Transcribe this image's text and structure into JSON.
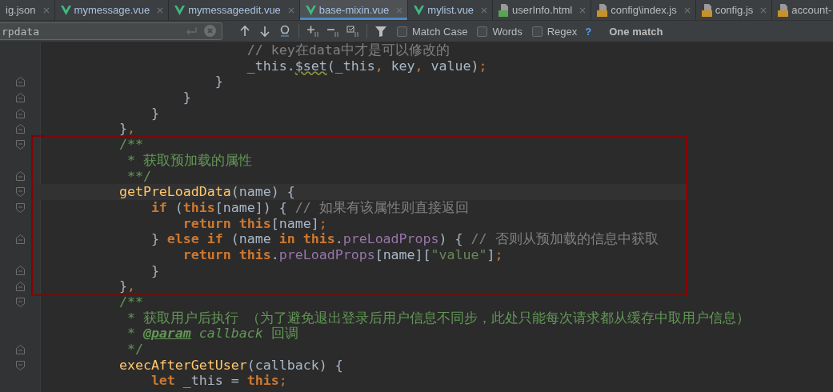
{
  "tabs": [
    {
      "label": "ig.json",
      "kind": "plain",
      "selected": false
    },
    {
      "label": "mymessage.vue",
      "kind": "vue",
      "selected": false
    },
    {
      "label": "mymessageedit.vue",
      "kind": "vue",
      "selected": false
    },
    {
      "label": "base-mixin.vue",
      "kind": "vue",
      "selected": true
    },
    {
      "label": "mylist.vue",
      "kind": "vue",
      "selected": false
    },
    {
      "label": "userInfo.html",
      "kind": "html",
      "selected": false
    },
    {
      "label": "config\\index.js",
      "kind": "js",
      "selected": false
    },
    {
      "label": "config.js",
      "kind": "js",
      "selected": false
    },
    {
      "label": "account-",
      "kind": "js",
      "selected": false
    }
  ],
  "search": {
    "value": "rpdata",
    "options": [
      {
        "label": "Match Case",
        "checked": false
      },
      {
        "label": "Words",
        "checked": false
      },
      {
        "label": "Regex",
        "checked": false
      }
    ],
    "help": "?",
    "result": "One match"
  },
  "editor": {
    "blocks": [
      {
        "highlighted": false,
        "lines": [
          {
            "kind": "plain",
            "current": false,
            "tokens": [
              {
                "kind": "comment",
                "text": "                        // key在data中才是可以修改的"
              }
            ]
          },
          {
            "kind": "plain",
            "current": false,
            "tokens": [
              {
                "kind": "plain",
                "text": "                        _this."
              },
              {
                "kind": "warn",
                "text": "$set"
              },
              {
                "kind": "plain",
                "text": "(_this"
              },
              {
                "kind": "punc",
                "text": ","
              },
              {
                "kind": "plain",
                "text": " key"
              },
              {
                "kind": "punc",
                "text": ","
              },
              {
                "kind": "plain",
                "text": " value)"
              },
              {
                "kind": "punc",
                "text": ";"
              }
            ]
          },
          {
            "kind": "fold-end",
            "current": false,
            "tokens": [
              {
                "kind": "plain",
                "text": "                    }"
              }
            ]
          },
          {
            "kind": "fold-end",
            "current": false,
            "tokens": [
              {
                "kind": "plain",
                "text": "                }"
              }
            ]
          },
          {
            "kind": "fold-end",
            "current": false,
            "tokens": [
              {
                "kind": "plain",
                "text": "            }"
              }
            ]
          },
          {
            "kind": "fold-end",
            "current": false,
            "tokens": [
              {
                "kind": "plain",
                "text": "        }"
              },
              {
                "kind": "punc",
                "text": ","
              }
            ]
          }
        ]
      },
      {
        "highlighted": true,
        "lines": [
          {
            "kind": "fold-start",
            "current": false,
            "tokens": [
              {
                "kind": "doc",
                "text": "        /**"
              }
            ]
          },
          {
            "kind": "plain",
            "current": false,
            "tokens": [
              {
                "kind": "doc",
                "text": "         * 获取预加载的属性"
              }
            ]
          },
          {
            "kind": "fold-end",
            "current": false,
            "tokens": [
              {
                "kind": "doc",
                "text": "         **/"
              }
            ]
          },
          {
            "kind": "fold-start",
            "current": true,
            "tokens": [
              {
                "kind": "fn",
                "text": "        getPreLoadData"
              },
              {
                "kind": "plain",
                "text": "(name) {"
              }
            ]
          },
          {
            "kind": "fold-start",
            "current": false,
            "tokens": [
              {
                "kind": "kw",
                "text": "            if"
              },
              {
                "kind": "plain",
                "text": " ("
              },
              {
                "kind": "kw",
                "text": "this"
              },
              {
                "kind": "plain",
                "text": "[name]) { "
              },
              {
                "kind": "comment",
                "text": "// 如果有该属性则直接返回"
              }
            ]
          },
          {
            "kind": "plain",
            "current": false,
            "tokens": [
              {
                "kind": "kw",
                "text": "                return this"
              },
              {
                "kind": "plain",
                "text": "[name]"
              },
              {
                "kind": "punc",
                "text": ";"
              }
            ]
          },
          {
            "kind": "fold-end",
            "current": false,
            "tokens": [
              {
                "kind": "plain",
                "text": "            } "
              },
              {
                "kind": "kw",
                "text": "else if"
              },
              {
                "kind": "plain",
                "text": " (name "
              },
              {
                "kind": "kw",
                "text": "in this"
              },
              {
                "kind": "plain",
                "text": "."
              },
              {
                "kind": "prop",
                "text": "preLoadProps"
              },
              {
                "kind": "plain",
                "text": ") { "
              },
              {
                "kind": "comment",
                "text": "// 否则从预加载的信息中获取"
              }
            ]
          },
          {
            "kind": "plain",
            "current": false,
            "tokens": [
              {
                "kind": "kw",
                "text": "                return this"
              },
              {
                "kind": "plain",
                "text": "."
              },
              {
                "kind": "prop",
                "text": "preLoadProps"
              },
              {
                "kind": "plain",
                "text": "[name]["
              },
              {
                "kind": "str",
                "text": "\"value\""
              },
              {
                "kind": "plain",
                "text": "]"
              },
              {
                "kind": "punc",
                "text": ";"
              }
            ]
          },
          {
            "kind": "fold-end",
            "current": false,
            "tokens": [
              {
                "kind": "plain",
                "text": "            }"
              }
            ]
          },
          {
            "kind": "fold-end",
            "current": false,
            "tokens": [
              {
                "kind": "plain",
                "text": "        }"
              },
              {
                "kind": "punc",
                "text": ","
              }
            ]
          }
        ]
      },
      {
        "highlighted": false,
        "lines": [
          {
            "kind": "fold-start",
            "current": false,
            "tokens": [
              {
                "kind": "doc",
                "text": "        /**"
              }
            ]
          },
          {
            "kind": "plain",
            "current": false,
            "tokens": [
              {
                "kind": "doc",
                "text": "         * 获取用户后执行 （为了避免退出登录后用户信息不同步，此处只能每次请求都从缓存中取用户信息）"
              }
            ]
          },
          {
            "kind": "plain",
            "current": false,
            "tokens": [
              {
                "kind": "doc",
                "text": "         * "
              },
              {
                "kind": "doctag",
                "text": "@param"
              },
              {
                "kind": "docitalic",
                "text": " callback"
              },
              {
                "kind": "doc",
                "text": " 回调"
              }
            ]
          },
          {
            "kind": "fold-end",
            "current": false,
            "tokens": [
              {
                "kind": "doc",
                "text": "         */"
              }
            ]
          },
          {
            "kind": "fold-start",
            "current": false,
            "tokens": [
              {
                "kind": "fn",
                "text": "        execAfterGetUser"
              },
              {
                "kind": "plain",
                "text": "(callback) {"
              }
            ]
          },
          {
            "kind": "plain",
            "current": false,
            "tokens": [
              {
                "kind": "kw",
                "text": "            let"
              },
              {
                "kind": "plain",
                "text": " _this = "
              },
              {
                "kind": "kw",
                "text": "this"
              },
              {
                "kind": "punc",
                "text": ";"
              }
            ]
          }
        ]
      }
    ]
  }
}
